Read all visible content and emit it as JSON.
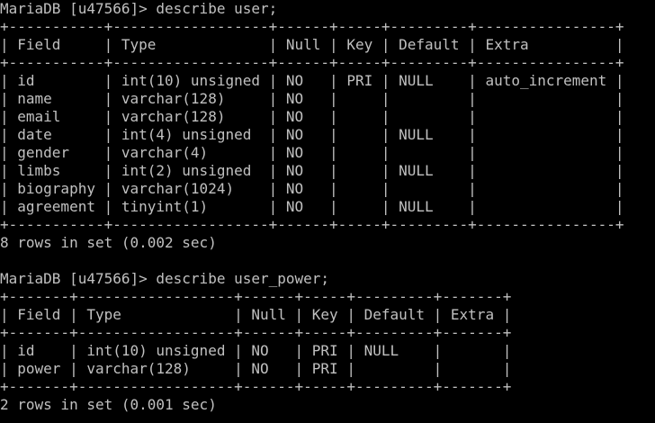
{
  "terminal": {
    "colors": {
      "background": "#000000",
      "foreground": "#c0c0c0"
    },
    "lines": [
      "MariaDB [u47566]> describe user;",
      "+-----------+------------------+------+-----+---------+----------------+",
      "| Field     | Type             | Null | Key | Default | Extra          |",
      "+-----------+------------------+------+-----+---------+----------------+",
      "| id        | int(10) unsigned | NO   | PRI | NULL    | auto_increment |",
      "| name      | varchar(128)     | NO   |     |         |                |",
      "| email     | varchar(128)     | NO   |     |         |                |",
      "| date      | int(4) unsigned  | NO   |     | NULL    |                |",
      "| gender    | varchar(4)       | NO   |     |         |                |",
      "| limbs     | int(2) unsigned  | NO   |     | NULL    |                |",
      "| biography | varchar(1024)    | NO   |     |         |                |",
      "| agreement | tinyint(1)       | NO   |     | NULL    |                |",
      "+-----------+------------------+------+-----+---------+----------------+",
      "8 rows in set (0.002 sec)",
      "",
      "MariaDB [u47566]> describe user_power;",
      "+-------+------------------+------+-----+---------+-------+",
      "| Field | Type             | Null | Key | Default | Extra |",
      "+-------+------------------+------+-----+---------+-------+",
      "| id    | int(10) unsigned | NO   | PRI | NULL    |       |",
      "| power | varchar(128)     | NO   | PRI |         |       |",
      "+-------+------------------+------+-----+---------+-------+",
      "2 rows in set (0.001 sec)"
    ]
  }
}
